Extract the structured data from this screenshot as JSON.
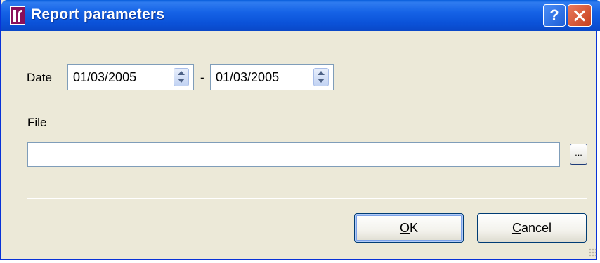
{
  "window": {
    "title": "Report parameters",
    "help_label": "?"
  },
  "form": {
    "date_label": "Date",
    "date_from": "01/03/2005",
    "date_separator": "-",
    "date_to": "01/03/2005",
    "file_label": "File",
    "file_value": "",
    "browse_label": "..."
  },
  "buttons": {
    "ok_mnemonic": "O",
    "ok_rest": "K",
    "cancel_mnemonic": "C",
    "cancel_rest": "ancel"
  },
  "colors": {
    "titlebar": "#0b52d8",
    "window_bg": "#ece9d8",
    "app_icon": "#8a0f5a",
    "close_button": "#d44d2a"
  },
  "icons": {
    "app": "app-logo-icon",
    "help": "help-icon",
    "close": "close-icon",
    "spin": "spin-up-down-icon",
    "resize": "resize-grip-icon"
  }
}
